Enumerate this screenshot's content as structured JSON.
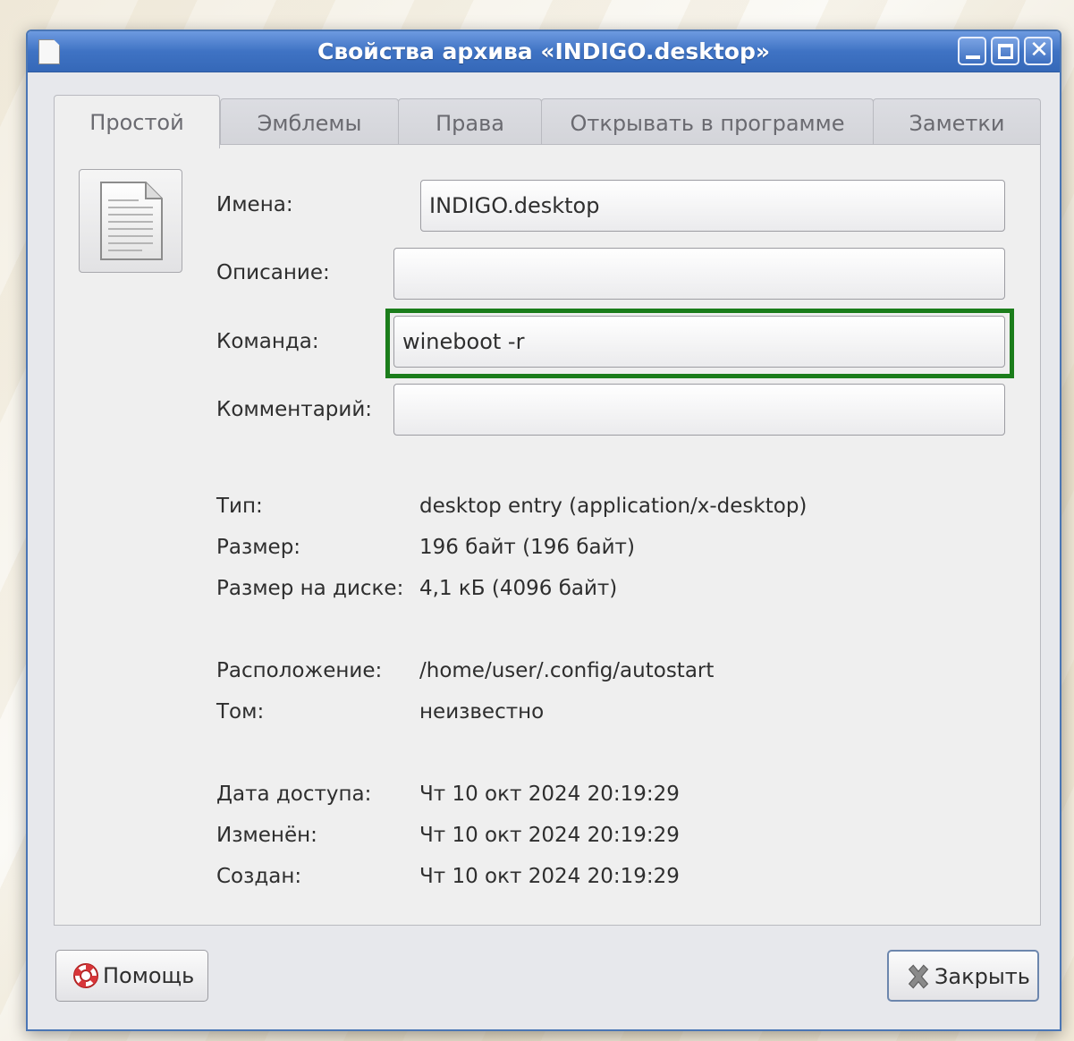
{
  "window": {
    "title": "Свойства архива «INDIGO.desktop»",
    "controls": {
      "minimize": "minimize",
      "maximize": "maximize",
      "close": "✕"
    }
  },
  "tabs": [
    {
      "label": "Простой",
      "active": true
    },
    {
      "label": "Эмблемы",
      "active": false
    },
    {
      "label": "Права",
      "active": false
    },
    {
      "label": "Открывать в программе",
      "active": false
    },
    {
      "label": "Заметки",
      "active": false
    }
  ],
  "fields": {
    "name": {
      "label": "Имена:",
      "value": "INDIGO.desktop"
    },
    "description": {
      "label": "Описание:",
      "value": ""
    },
    "command": {
      "label": "Команда:",
      "value": "wineboot -r"
    },
    "comment": {
      "label": "Комментарий:",
      "value": ""
    }
  },
  "info": {
    "type": {
      "label": "Тип:",
      "value": "desktop entry (application/x-desktop)"
    },
    "size": {
      "label": "Размер:",
      "value": "196 байт (196 байт)"
    },
    "disk_size": {
      "label": "Размер на диске:",
      "value": "4,1 кБ (4096 байт)"
    },
    "location": {
      "label": "Расположение:",
      "value": "/home/user/.config/autostart"
    },
    "volume": {
      "label": "Том:",
      "value": "неизвестно"
    },
    "accessed": {
      "label": "Дата доступа:",
      "value": "Чт 10 окт 2024 20:19:29"
    },
    "modified": {
      "label": "Изменён:",
      "value": "Чт 10 окт 2024 20:19:29"
    },
    "created": {
      "label": "Создан:",
      "value": "Чт 10 окт 2024 20:19:29"
    }
  },
  "buttons": {
    "help": {
      "label": "Помощь",
      "icon": "lifebuoy-icon"
    },
    "close": {
      "label": "Закрыть",
      "icon": "close-x-icon"
    }
  },
  "colors": {
    "titlebar": "#3f73c4",
    "highlight": "#1b7d1b"
  }
}
